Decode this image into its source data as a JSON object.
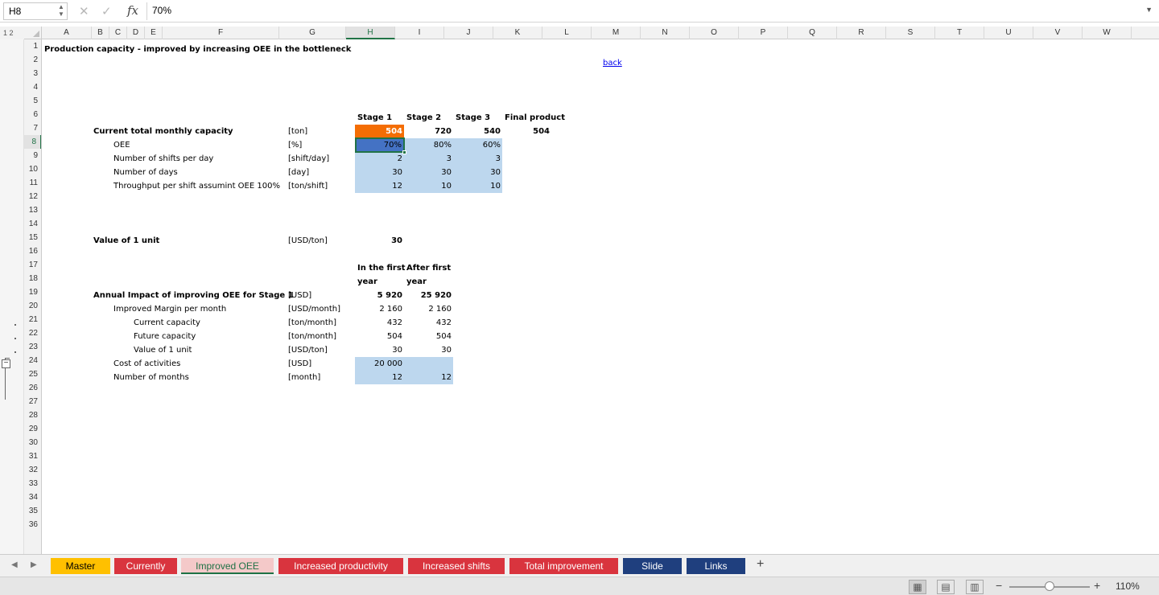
{
  "formula_bar": {
    "name_box": "H8",
    "fx_label": "fx",
    "value": "70%",
    "cancel_glyph": "✕",
    "confirm_glyph": "✓"
  },
  "outline_levels": "1 2",
  "columns": [
    "A",
    "B",
    "C",
    "D",
    "E",
    "F",
    "G",
    "H",
    "I",
    "J",
    "K",
    "L",
    "M",
    "N",
    "O",
    "P",
    "Q",
    "R",
    "S",
    "T",
    "U",
    "V",
    "W"
  ],
  "active_column": "H",
  "rows": [
    "1",
    "2",
    "3",
    "4",
    "5",
    "6",
    "7",
    "8",
    "9",
    "10",
    "11",
    "12",
    "13",
    "14",
    "15",
    "16",
    "17",
    "18",
    "19",
    "20",
    "21",
    "22",
    "23",
    "24",
    "25",
    "26",
    "27",
    "28",
    "29",
    "30",
    "31",
    "32",
    "33",
    "34",
    "35",
    "36"
  ],
  "active_row": "8",
  "sheet": {
    "title": "Production capacity - improved by increasing OEE in the bottleneck",
    "back_link": "back",
    "headers": {
      "stage1": "Stage 1",
      "stage2": "Stage 2",
      "stage3": "Stage 3",
      "final": "Final product"
    },
    "capacity_table": [
      {
        "label": "Current total monthly capacity",
        "unit": "[ton]",
        "h": "504",
        "i": "720",
        "j": "540",
        "k": "504"
      },
      {
        "label": "OEE",
        "unit": "[%]",
        "h": "70%",
        "i": "80%",
        "j": "60%"
      },
      {
        "label": "Number of shifts per day",
        "unit": "[shift/day]",
        "h": "2",
        "i": "3",
        "j": "3"
      },
      {
        "label": "Number of days",
        "unit": "[day]",
        "h": "30",
        "i": "30",
        "j": "30"
      },
      {
        "label": "Throughput per shift assumint OEE 100%",
        "unit": "[ton/shift]",
        "h": "12",
        "i": "10",
        "j": "10"
      }
    ],
    "value_unit": {
      "label": "Value of 1 unit",
      "unit": "[USD/ton]",
      "value": "30"
    },
    "impact_headers": {
      "first_a": "In the first",
      "first_b": "year",
      "after_a": "After first",
      "after_b": "year"
    },
    "impact_table": [
      {
        "label": "Annual Impact of improving OEE for Stage 1",
        "unit": "[USD]",
        "h": "5 920",
        "i": "25 920"
      },
      {
        "label": "Improved Margin per month",
        "unit": "[USD/month]",
        "h": "2 160",
        "i": "2 160"
      },
      {
        "label": "Current capacity",
        "unit": "[ton/month]",
        "h": "432",
        "i": "432"
      },
      {
        "label": "Future capacity",
        "unit": "[ton/month]",
        "h": "504",
        "i": "504"
      },
      {
        "label": "Value of 1 unit",
        "unit": "[USD/ton]",
        "h": "30",
        "i": "30"
      },
      {
        "label": "Cost of activities",
        "unit": "[USD]",
        "h": "20 000",
        "i": ""
      },
      {
        "label": "Number of months",
        "unit": "[month]",
        "h": "12",
        "i": "12"
      }
    ]
  },
  "tabs": [
    {
      "label": "Master",
      "style": "yellow"
    },
    {
      "label": "Currently",
      "style": "red"
    },
    {
      "label": "Improved OEE",
      "style": "active"
    },
    {
      "label": "Increased productivity",
      "style": "red"
    },
    {
      "label": "Increased shifts",
      "style": "red"
    },
    {
      "label": "Total improvement",
      "style": "red"
    },
    {
      "label": "Slide",
      "style": "navy"
    },
    {
      "label": "Links",
      "style": "navy"
    }
  ],
  "add_sheet": "+",
  "status_bar": {
    "zoom": "110%",
    "zoom_minus": "−",
    "zoom_plus": "+"
  },
  "colors": {
    "input_fill": "#bdd7ee",
    "bottleneck_fill": "#f46d04",
    "selection_border": "#217346",
    "selected_fill": "#4472c4"
  }
}
